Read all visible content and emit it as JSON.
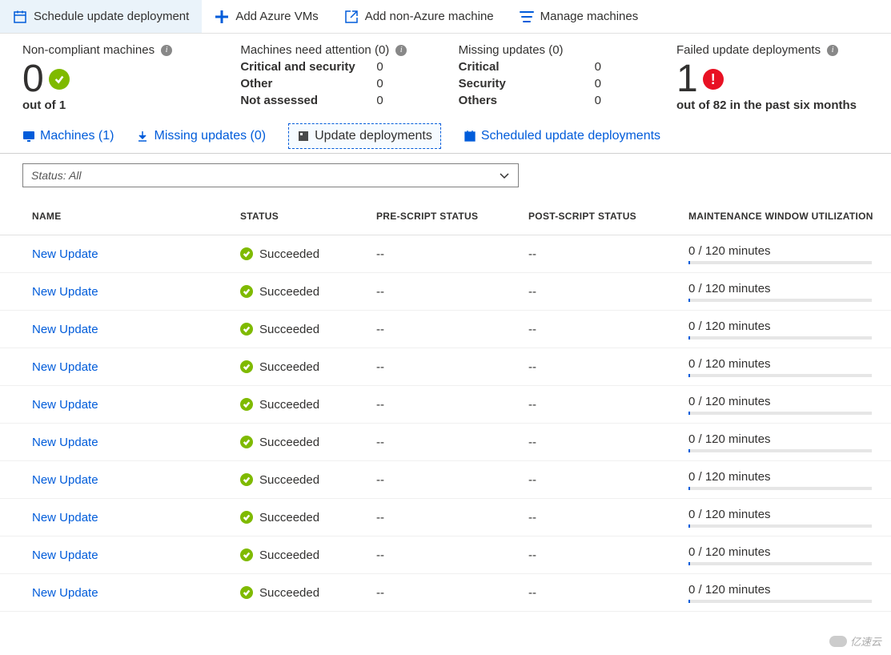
{
  "toolbar": {
    "schedule": "Schedule update deployment",
    "addAzure": "Add Azure VMs",
    "addNonAzure": "Add non-Azure machine",
    "manage": "Manage machines"
  },
  "stats": {
    "noncompliant": {
      "label": "Non-compliant machines",
      "value": "0",
      "sub": "out of 1"
    },
    "attention": {
      "label": "Machines need attention (0)",
      "rows": [
        {
          "k": "Critical and security",
          "v": "0"
        },
        {
          "k": "Other",
          "v": "0"
        },
        {
          "k": "Not assessed",
          "v": "0"
        }
      ]
    },
    "missing": {
      "label": "Missing updates (0)",
      "rows": [
        {
          "k": "Critical",
          "v": "0"
        },
        {
          "k": "Security",
          "v": "0"
        },
        {
          "k": "Others",
          "v": "0"
        }
      ]
    },
    "failed": {
      "label": "Failed update deployments",
      "value": "1",
      "sub": "out of 82 in the past six months"
    }
  },
  "tabs": {
    "machines": "Machines (1)",
    "missing": "Missing updates (0)",
    "deployments": "Update deployments",
    "scheduled": "Scheduled update deployments"
  },
  "filter": {
    "text": "Status: All"
  },
  "table": {
    "headers": {
      "name": "NAME",
      "status": "STATUS",
      "pre": "PRE-SCRIPT STATUS",
      "post": "POST-SCRIPT STATUS",
      "maint": "MAINTENANCE WINDOW UTILIZATION"
    },
    "rows": [
      {
        "name": "New Update",
        "status": "Succeeded",
        "pre": "--",
        "post": "--",
        "maint": "0 / 120 minutes"
      },
      {
        "name": "New Update",
        "status": "Succeeded",
        "pre": "--",
        "post": "--",
        "maint": "0 / 120 minutes"
      },
      {
        "name": "New Update",
        "status": "Succeeded",
        "pre": "--",
        "post": "--",
        "maint": "0 / 120 minutes"
      },
      {
        "name": "New Update",
        "status": "Succeeded",
        "pre": "--",
        "post": "--",
        "maint": "0 / 120 minutes"
      },
      {
        "name": "New Update",
        "status": "Succeeded",
        "pre": "--",
        "post": "--",
        "maint": "0 / 120 minutes"
      },
      {
        "name": "New Update",
        "status": "Succeeded",
        "pre": "--",
        "post": "--",
        "maint": "0 / 120 minutes"
      },
      {
        "name": "New Update",
        "status": "Succeeded",
        "pre": "--",
        "post": "--",
        "maint": "0 / 120 minutes"
      },
      {
        "name": "New Update",
        "status": "Succeeded",
        "pre": "--",
        "post": "--",
        "maint": "0 / 120 minutes"
      },
      {
        "name": "New Update",
        "status": "Succeeded",
        "pre": "--",
        "post": "--",
        "maint": "0 / 120 minutes"
      },
      {
        "name": "New Update",
        "status": "Succeeded",
        "pre": "--",
        "post": "--",
        "maint": "0 / 120 minutes"
      }
    ]
  },
  "watermark": "亿速云"
}
